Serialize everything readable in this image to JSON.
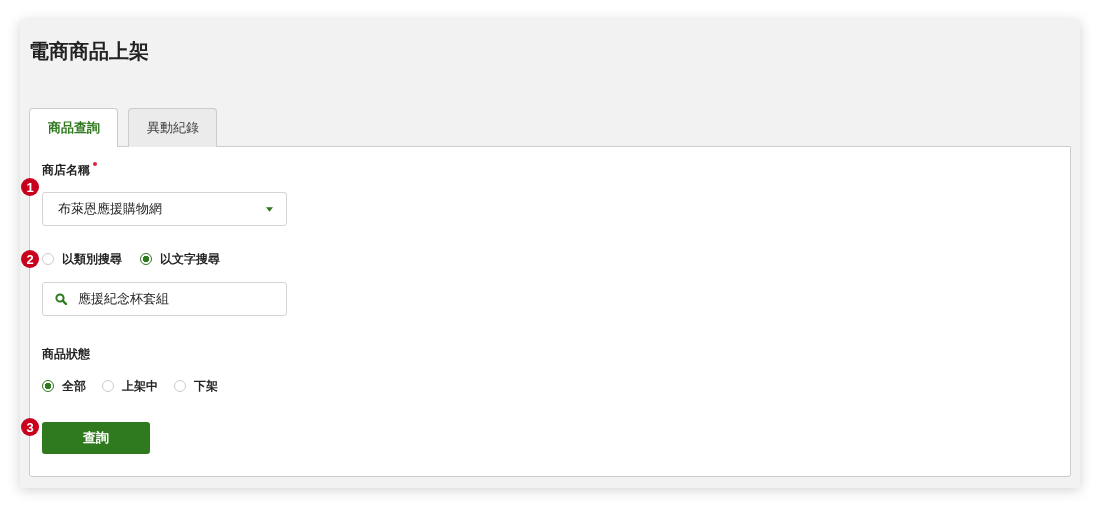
{
  "title": "電商商品上架",
  "tabs": [
    {
      "label": "商品查詢",
      "selected": true
    },
    {
      "label": "異動紀錄",
      "selected": false
    }
  ],
  "shop": {
    "marker": "1",
    "label": "商店名稱",
    "required": true,
    "value": "布萊恩應援購物網"
  },
  "search_mode": {
    "marker": "2",
    "options": [
      {
        "label": "以類別搜尋",
        "selected": false
      },
      {
        "label": "以文字搜尋",
        "selected": true
      }
    ]
  },
  "search_field": {
    "value": "應援紀念杯套組"
  },
  "status": {
    "label": "商品狀態",
    "options": [
      {
        "label": "全部",
        "selected": true
      },
      {
        "label": "上架中",
        "selected": false
      },
      {
        "label": "下架",
        "selected": false
      }
    ]
  },
  "query_button": {
    "marker": "3",
    "label": "查詢"
  }
}
